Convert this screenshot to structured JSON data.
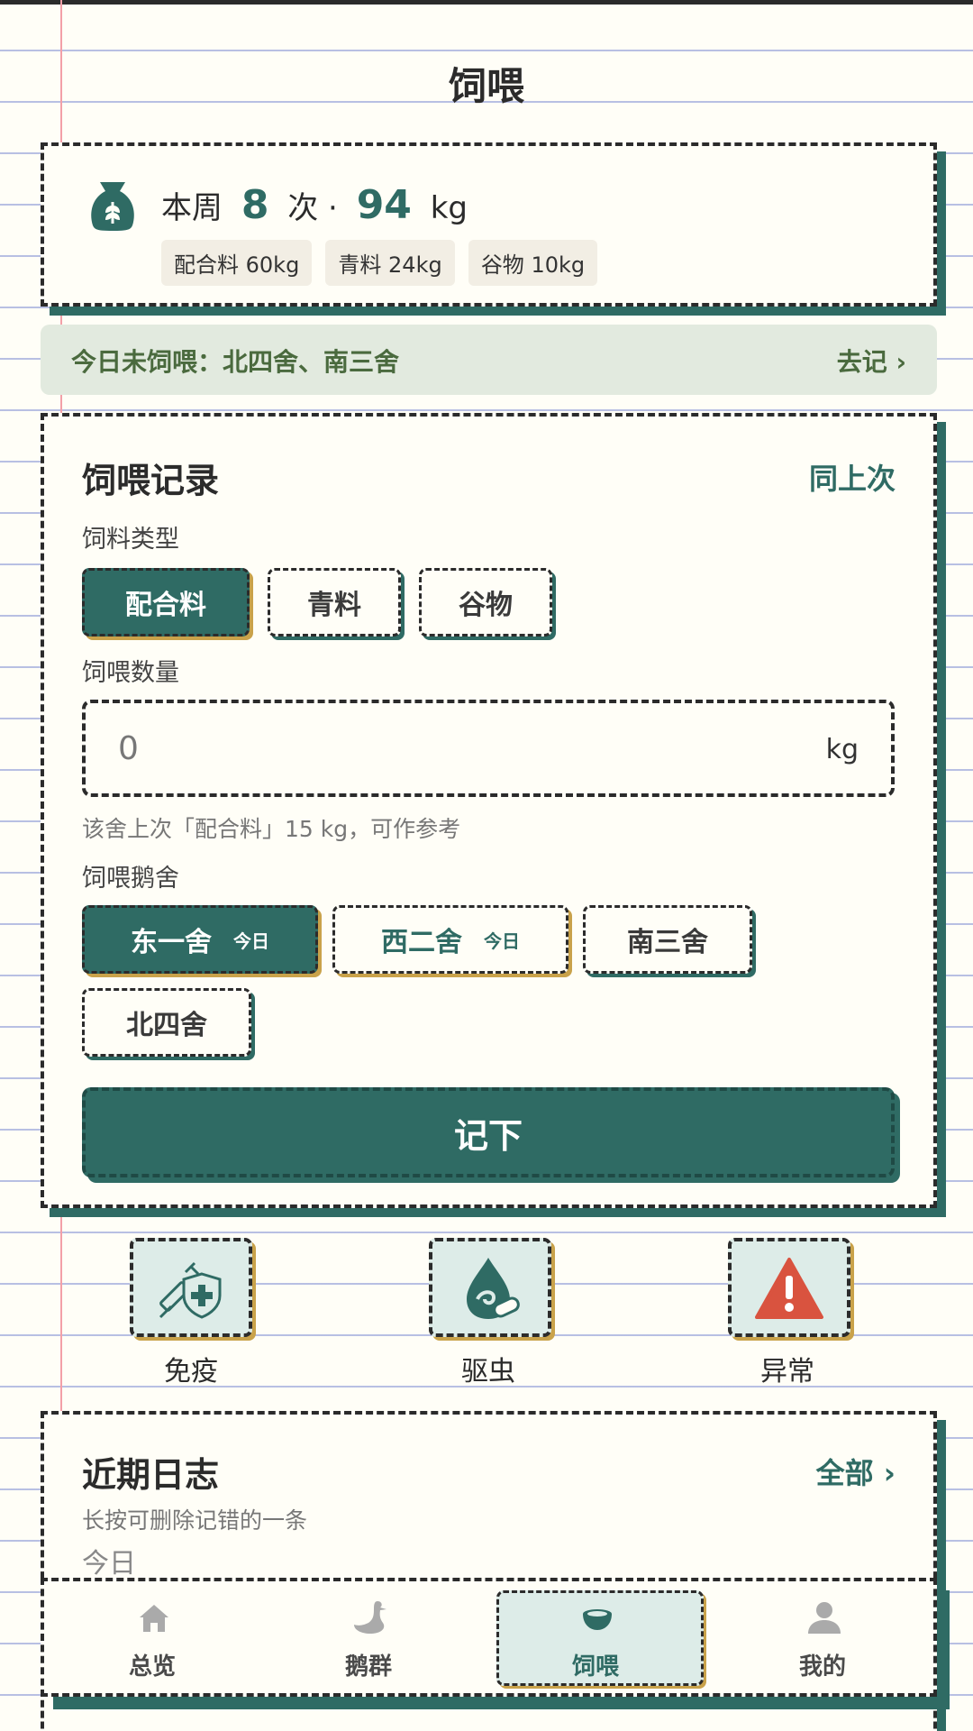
{
  "header": {
    "title": "饲喂"
  },
  "summary": {
    "prefix": "本周",
    "count": "8",
    "count_unit": "次 ·",
    "weight": "94",
    "weight_unit": "kg",
    "chips": [
      "配合料 60kg",
      "青料 24kg",
      "谷物 10kg"
    ]
  },
  "alert": {
    "text": "今日未饲喂：北四舍、南三舍",
    "action": "去记 ›"
  },
  "feed_form": {
    "title": "饲喂记录",
    "same_last": "同上次",
    "feed_type_label": "饲料类型",
    "feed_types": [
      {
        "label": "配合料",
        "selected": true
      },
      {
        "label": "青料",
        "selected": false
      },
      {
        "label": "谷物",
        "selected": false
      }
    ],
    "quantity_label": "饲喂数量",
    "quantity_value": "0",
    "quantity_unit": "kg",
    "hint": "该舍上次「配合料」15 kg，可作参考",
    "house_label": "饲喂鹅舍",
    "houses": [
      {
        "label": "东一舍",
        "tag": "今日",
        "selected": true
      },
      {
        "label": "西二舍",
        "tag": "今日",
        "selected": false
      },
      {
        "label": "南三舍",
        "tag": "",
        "selected": false
      },
      {
        "label": "北四舍",
        "tag": "",
        "selected": false
      }
    ],
    "submit": "记下"
  },
  "quick_actions": [
    {
      "label": "免疫",
      "icon": "vaccine-shield-icon"
    },
    {
      "label": "驱虫",
      "icon": "deworm-drop-icon"
    },
    {
      "label": "异常",
      "icon": "warning-icon"
    }
  ],
  "log": {
    "title": "近期日志",
    "all": "全部 ›",
    "subtitle": "长按可删除记错的一条",
    "today": "今日"
  },
  "nav": {
    "items": [
      {
        "label": "总览",
        "icon": "home-icon"
      },
      {
        "label": "鹅群",
        "icon": "goose-icon"
      },
      {
        "label": "饲喂",
        "icon": "feed-bowl-icon"
      },
      {
        "label": "我的",
        "icon": "user-icon"
      }
    ],
    "active_index": 2
  },
  "colors": {
    "primary": "#2F6B64",
    "accent_gold": "#C9A24A",
    "paper": "#FFFEF7",
    "alert_bg": "#E2EADF",
    "warning_red": "#D9533F"
  }
}
